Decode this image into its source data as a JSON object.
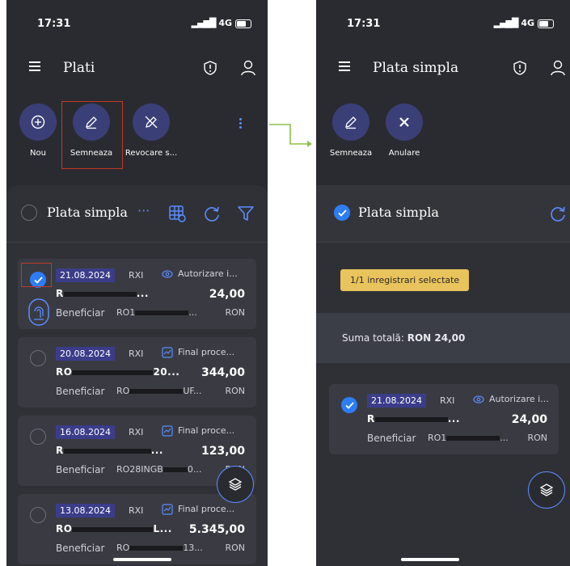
{
  "status_bar": {
    "time": "17:31",
    "network": "4G"
  },
  "screen1": {
    "title": "Plati",
    "actions": [
      {
        "label": "Nou",
        "icon": "plus-circle-icon"
      },
      {
        "label": "Semneaza",
        "icon": "pen-icon"
      },
      {
        "label": "Revocare s...",
        "icon": "pen-off-icon"
      }
    ],
    "section_title": "Plata simpla",
    "section_more": "···",
    "payments": [
      {
        "date": "21.08.2024",
        "type": "RXI",
        "status": "Autorizare i...",
        "account_prefix": "R",
        "account_suffix": "...",
        "amount": "24,00",
        "beneficiary_label": "Beneficiar",
        "beneficiary_account": "RO1",
        "beneficiary_suffix": "...",
        "currency": "RON",
        "selected": true
      },
      {
        "date": "20.08.2024",
        "type": "RXI",
        "status": "Final proce...",
        "account_prefix": "RO",
        "account_suffix": "20...",
        "amount": "344,00",
        "beneficiary_label": "Beneficiar",
        "beneficiary_account": "RO",
        "beneficiary_suffix": "UF...",
        "currency": "RON",
        "selected": false
      },
      {
        "date": "16.08.2024",
        "type": "RXI",
        "status": "Final proce...",
        "account_prefix": "R",
        "account_suffix": "...",
        "amount": "123,00",
        "beneficiary_label": "Beneficiar",
        "beneficiary_account": "RO28INGB",
        "beneficiary_suffix": "0...",
        "currency": "RON",
        "selected": false
      },
      {
        "date": "13.08.2024",
        "type": "RXI",
        "status": "Final proce...",
        "account_prefix": "RO",
        "account_suffix": "L...",
        "amount": "5.345,00",
        "beneficiary_label": "Beneficiar",
        "beneficiary_account": "RO",
        "beneficiary_suffix": "13...",
        "currency": "RON",
        "selected": false
      }
    ]
  },
  "screen2": {
    "title": "Plata simpla",
    "actions": [
      {
        "label": "Semneaza",
        "icon": "pen-icon"
      },
      {
        "label": "Anulare",
        "icon": "close-icon"
      }
    ],
    "section_title": "Plata simpla",
    "selected_badge": "1/1 inregistrari selectate",
    "sum_label": "Suma totală: ",
    "sum_value": "RON 24,00",
    "payment": {
      "date": "21.08.2024",
      "type": "RXI",
      "status": "Autorizare i...",
      "account_prefix": "R",
      "account_suffix": "...",
      "amount": "24,00",
      "beneficiary_label": "Beneficiar",
      "beneficiary_account": "RO1",
      "beneficiary_suffix": "...",
      "currency": "RON"
    }
  },
  "colors": {
    "background": "#2a2b31",
    "accent": "#2d7df6",
    "action_circle": "#3a3f77",
    "badge": "#e9c35c",
    "arrow": "#8bc34a",
    "highlight": "#c0392b"
  }
}
